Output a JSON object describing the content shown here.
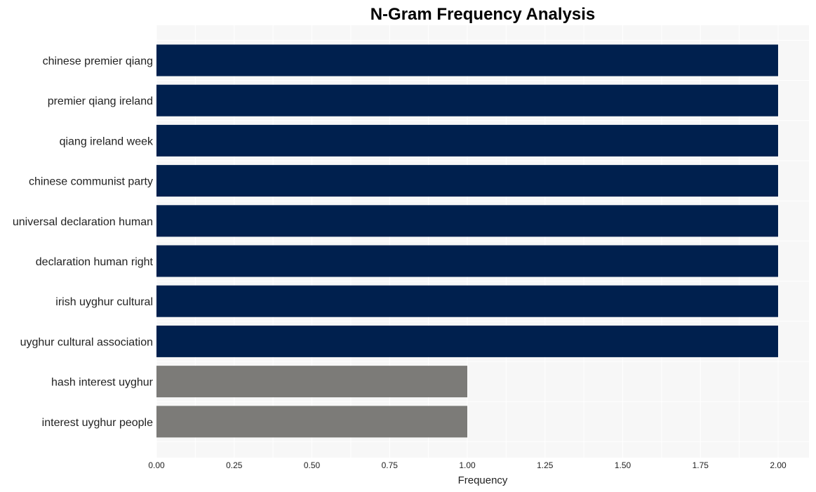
{
  "chart_data": {
    "type": "bar",
    "orientation": "horizontal",
    "title": "N-Gram Frequency Analysis",
    "xlabel": "Frequency",
    "ylabel": "",
    "xlim": [
      0,
      2.1
    ],
    "xticks": [
      0,
      0.25,
      0.5,
      0.75,
      1.0,
      1.25,
      1.5,
      1.75,
      2.0
    ],
    "xtick_labels": [
      "0.00",
      "0.25",
      "0.50",
      "0.75",
      "1.00",
      "1.25",
      "1.50",
      "1.75",
      "2.00"
    ],
    "grid": true,
    "categories": [
      "chinese premier qiang",
      "premier qiang ireland",
      "qiang ireland week",
      "chinese communist party",
      "universal declaration human",
      "declaration human right",
      "irish uyghur cultural",
      "uyghur cultural association",
      "hash interest uyghur",
      "interest uyghur people"
    ],
    "values": [
      2,
      2,
      2,
      2,
      2,
      2,
      2,
      2,
      1,
      1
    ],
    "colors": {
      "top": "#00204e",
      "other": "#7c7b78",
      "plot_background": "#f7f7f7",
      "grid": "#ffffff"
    }
  }
}
